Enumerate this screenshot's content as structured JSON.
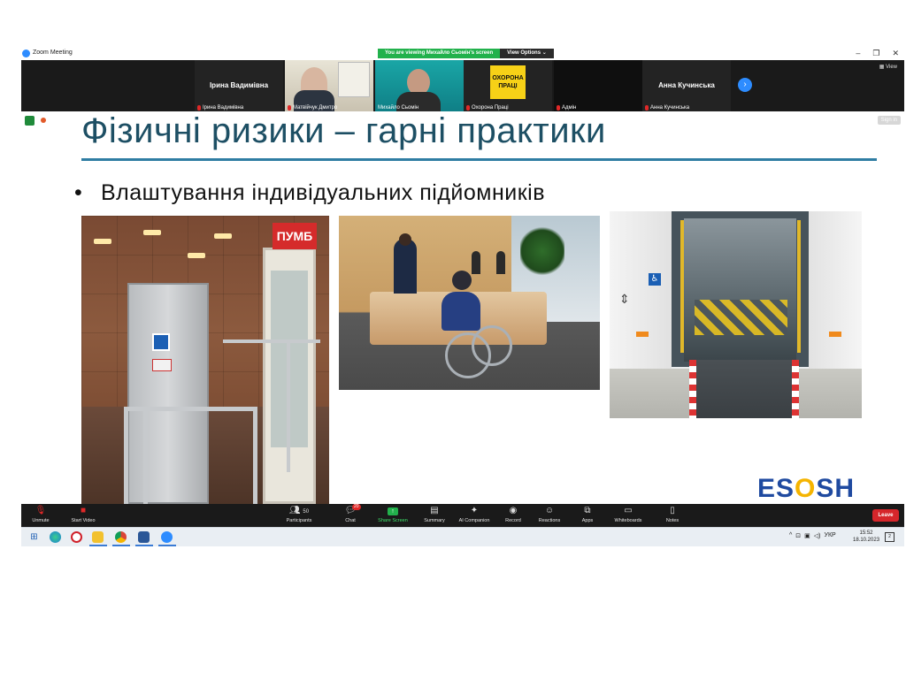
{
  "window": {
    "title": "Zoom Meeting",
    "viewing_message": "You are viewing Михайло Сьомін's screen",
    "view_options": "View Options",
    "controls": [
      "–",
      "❐",
      "✕"
    ]
  },
  "gallery": {
    "view_label": "View",
    "tiles": [
      {
        "big": "Ірина Вадимівна",
        "tag": "Ірина Вадимівна"
      },
      {
        "big": "",
        "tag": "Матвійчук Дмитро"
      },
      {
        "big": "",
        "tag": "Михайло Сьомін"
      },
      {
        "big": "",
        "tag": "Охорона Праці",
        "poster": "ОХОРОНА ПРАЦІ"
      },
      {
        "big": "",
        "tag": "Адмін"
      },
      {
        "big": "Анна Кучинська",
        "tag": "Анна Кучинська"
      }
    ]
  },
  "slide": {
    "sign_in": "Sign in",
    "title": "Фізичні ризики – гарні практики",
    "bullet_mark": "•",
    "bullet": "Влаштування індивідуальних підйомників",
    "bank_sign": "ПУМБ",
    "logo_left": "ES",
    "logo_o": "O",
    "logo_right": "SH"
  },
  "toolbar": {
    "items": [
      {
        "label": "Unmute",
        "icon": "mic-off-icon"
      },
      {
        "label": "Start Video",
        "icon": "video-off-icon"
      },
      {
        "label": "Participants",
        "icon": "participants-icon",
        "count": "50"
      },
      {
        "label": "Chat",
        "icon": "chat-icon",
        "badge": "20"
      },
      {
        "label": "Share Screen",
        "icon": "share-screen-icon"
      },
      {
        "label": "Summary",
        "icon": "summary-icon"
      },
      {
        "label": "AI Companion",
        "icon": "ai-companion-icon"
      },
      {
        "label": "Record",
        "icon": "record-icon"
      },
      {
        "label": "Reactions",
        "icon": "reactions-icon"
      },
      {
        "label": "Apps",
        "icon": "apps-icon"
      },
      {
        "label": "Whiteboards",
        "icon": "whiteboards-icon"
      },
      {
        "label": "Notes",
        "icon": "notes-icon"
      }
    ],
    "leave": "Leave"
  },
  "taskbar": {
    "lang": "УКР",
    "time": "15:52",
    "date": "18.10.2023",
    "notifications": "2"
  },
  "colors": {
    "title": "#1d4f64",
    "rule": "#2f7da3",
    "zoom_blue": "#2d8cff",
    "share_green": "#22b14c",
    "leave_red": "#d6262b"
  }
}
